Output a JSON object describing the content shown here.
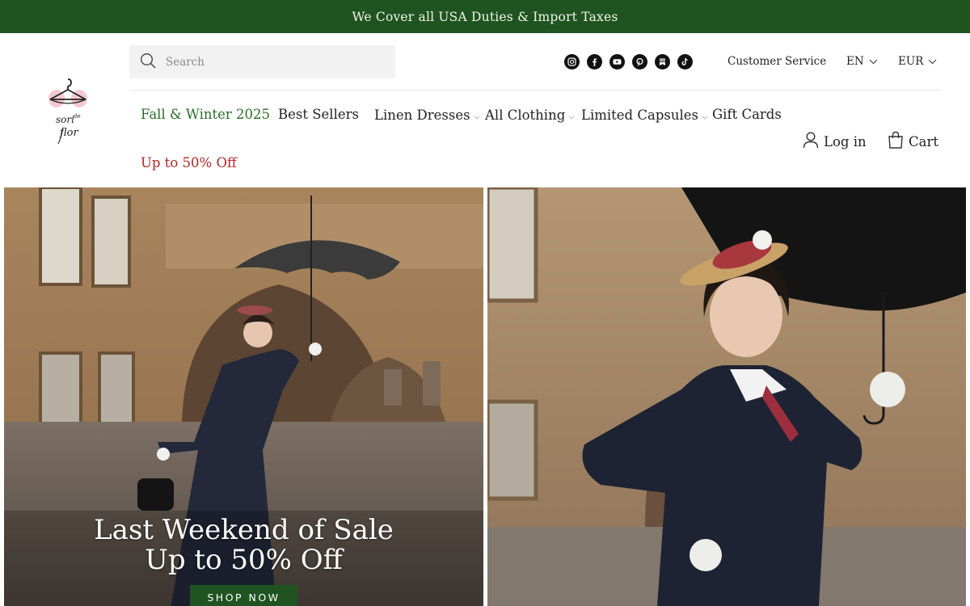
{
  "announcement": {
    "text": "We Cover all USA Duties & Import Taxes"
  },
  "brand": {
    "logo_text": "sori de flor"
  },
  "search": {
    "placeholder": "Search"
  },
  "socials": [
    "instagram-icon",
    "facebook-icon",
    "youtube-icon",
    "pinterest-icon",
    "substack-icon",
    "tiktok-icon"
  ],
  "top_links": {
    "customer_service": "Customer Service",
    "language": "EN",
    "currency": "EUR"
  },
  "nav": {
    "items": [
      {
        "label": "Fall & Winter 2025",
        "has_dropdown": false
      },
      {
        "label": "Best Sellers",
        "has_dropdown": false
      },
      {
        "label": "Linen Dresses",
        "has_dropdown": true
      },
      {
        "label": "All Clothing",
        "has_dropdown": true
      },
      {
        "label": "Limited Capsules",
        "has_dropdown": true
      },
      {
        "label": "Gift Cards",
        "has_dropdown": false
      },
      {
        "label": "Up to 50% Off",
        "has_dropdown": false
      }
    ]
  },
  "account": {
    "login_label": "Log in",
    "cart_label": "Cart"
  },
  "hero": {
    "title_line1": "Last Weekend of Sale",
    "title_line2": "Up to 50% Off",
    "cta": "SHOP NOW"
  },
  "colors": {
    "brand_green": "#1f5420",
    "nav_green": "#2a6e2a",
    "sale_red": "#b3262a"
  }
}
